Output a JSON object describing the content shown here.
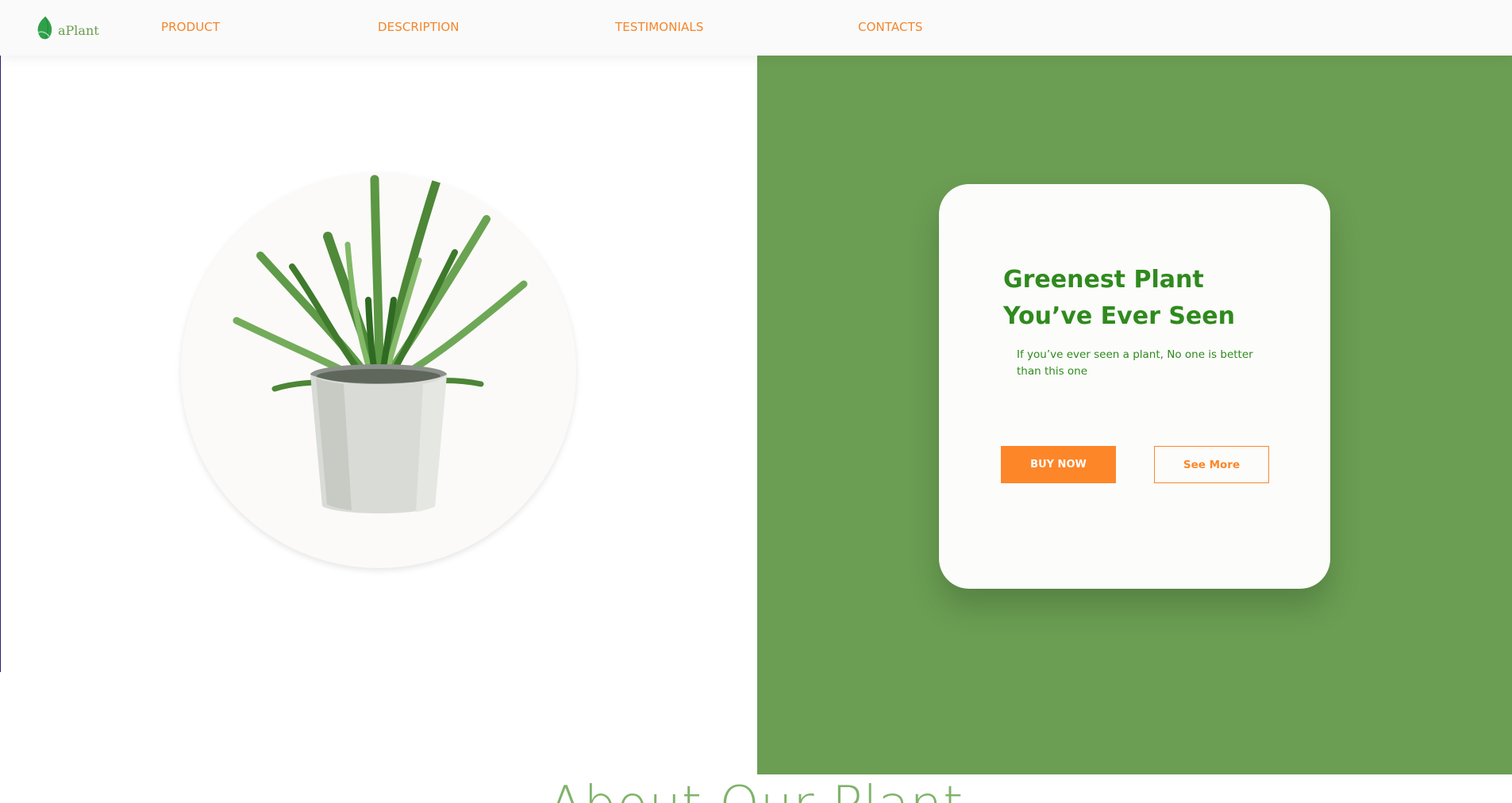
{
  "colors": {
    "accent_orange": "#fd8629",
    "brand_green": "#6b9e53",
    "title_green": "#2f8a1d",
    "about_green": "#7fb36a",
    "card_bg": "#fcfcfb"
  },
  "nav": {
    "logo": {
      "text": "aPlant",
      "icon": "leaf-icon"
    },
    "links": [
      {
        "label": "PRODUCT"
      },
      {
        "label": "DESCRIPTION"
      },
      {
        "label": "TESTIMONIALS"
      },
      {
        "label": "CONTACTS"
      }
    ]
  },
  "hero": {
    "image": {
      "icon": "potted-plant-image"
    },
    "card": {
      "title": "Greenest Plant You’ve Ever Seen",
      "subtitle": "If you’ve ever seen a plant, No one is better than this one",
      "buy_label": "BUY NOW",
      "more_label": "See More"
    }
  },
  "about": {
    "title": "About Our Plant"
  }
}
